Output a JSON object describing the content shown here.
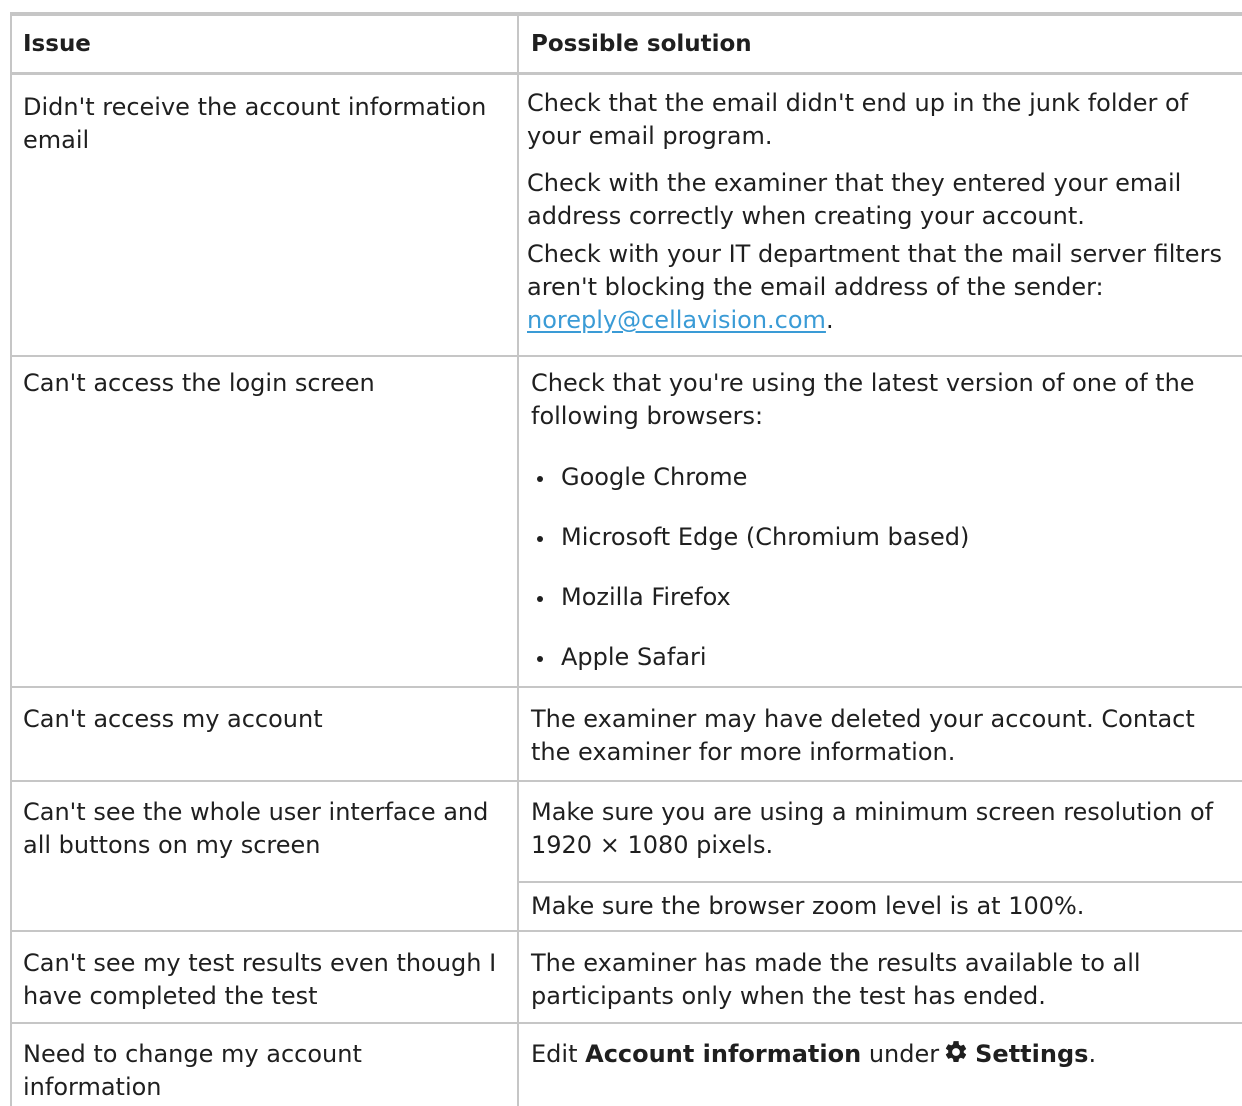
{
  "header": {
    "issue": "Issue",
    "solution": "Possible solution"
  },
  "rows": [
    {
      "issue": "Didn't receive the account information email",
      "solutions": [
        "Check that the email didn't end up in the junk folder of your email program.",
        "Check with the examiner that they entered your email address correctly when creating your account.",
        "Check with your IT department that the mail server filters aren't blocking the email address of the sender:"
      ],
      "link": "noreply@cellavision.com",
      "link_suffix": "."
    },
    {
      "issue": "Can't access the login screen",
      "solution": "Check that you're using the latest version of one of the following browsers:",
      "browsers": [
        "Google Chrome",
        "Microsoft Edge (Chromium based)",
        "Mozilla Firefox",
        "Apple Safari"
      ]
    },
    {
      "issue": "Can't access my account",
      "solution": "The examiner may have deleted your account. Contact the examiner for more information."
    },
    {
      "issue": "Can't see the whole user interface and all buttons on my screen",
      "solutions": [
        "Make sure you are using a minimum screen resolution of 1920 × 1080 pixels.",
        "Make sure the browser zoom level is at 100%."
      ]
    },
    {
      "issue": "Can't see my test results even though I have completed the test",
      "solution": "The examiner has made the results available to all participants only when the test has ended."
    },
    {
      "issue": "Need to change my account information",
      "solution_prefix": "Edit",
      "solution_bold_1": "Account information",
      "solution_mid": "under",
      "settings_icon": "gear-icon",
      "solution_bold_2": "Settings",
      "solution_suffix": "."
    }
  ],
  "colors": {
    "border": "#c6c6c6",
    "link": "#3a9bd6",
    "text": "#1f1f1f"
  }
}
